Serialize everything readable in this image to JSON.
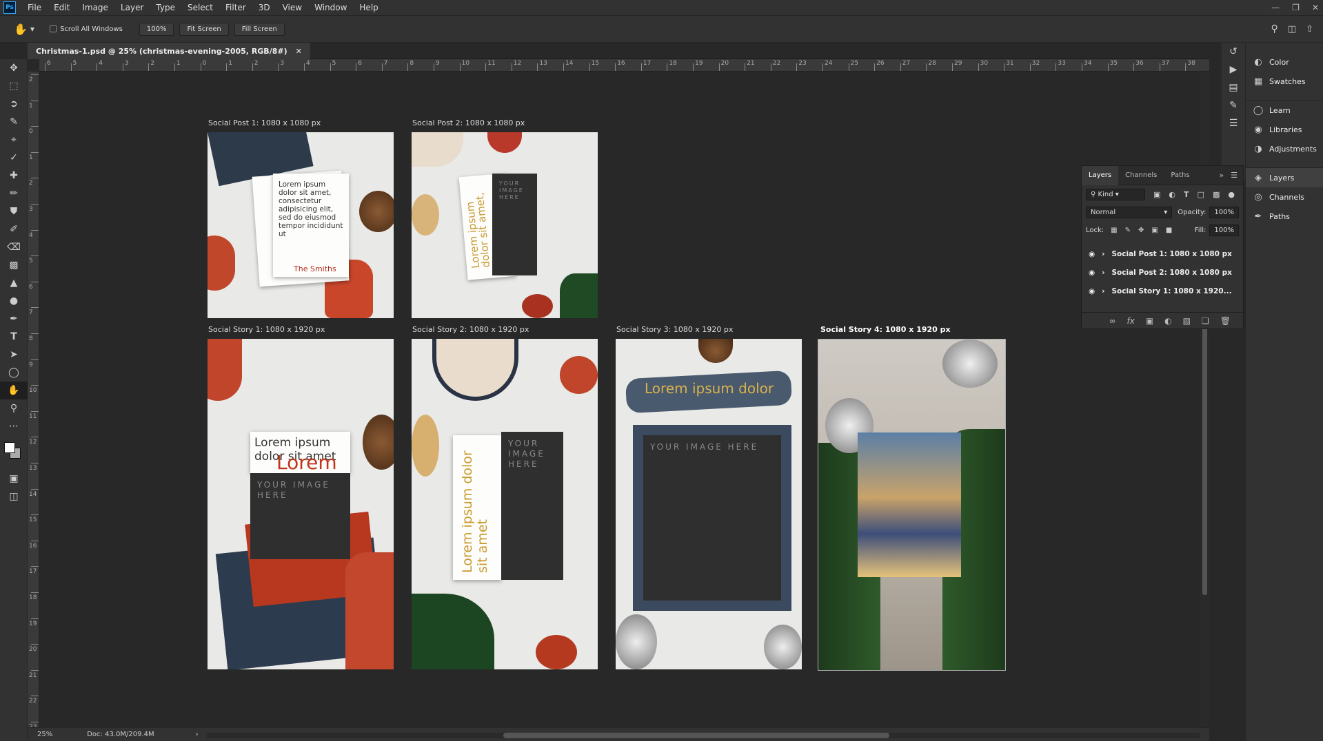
{
  "menu": [
    "File",
    "Edit",
    "Image",
    "Layer",
    "Type",
    "Select",
    "Filter",
    "3D",
    "View",
    "Window",
    "Help"
  ],
  "app_badge": "Ps",
  "options": {
    "scroll_all": "Scroll All Windows",
    "zoom_btn": "100%",
    "fit_screen": "Fit Screen",
    "fill_screen": "Fill Screen"
  },
  "document_tab": "Christmas-1.psd @ 25% (christmas-evening-2005, RGB/8#)",
  "ruler_h_labels": [
    "6",
    "5",
    "4",
    "3",
    "2",
    "1",
    "0",
    "1",
    "2",
    "3",
    "4",
    "5",
    "6",
    "7",
    "8",
    "9",
    "10",
    "11",
    "12",
    "13",
    "14",
    "15",
    "16",
    "17",
    "18",
    "19",
    "20",
    "21",
    "22",
    "23",
    "24",
    "25",
    "26",
    "27",
    "28",
    "29",
    "30",
    "31",
    "32",
    "33",
    "34",
    "35",
    "36",
    "37",
    "38"
  ],
  "ruler_v_labels": [
    "2",
    "1",
    "0",
    "1",
    "2",
    "3",
    "4",
    "5",
    "6",
    "7",
    "8",
    "9",
    "10",
    "11",
    "12",
    "13",
    "14",
    "15",
    "16",
    "17",
    "18",
    "19",
    "20",
    "21",
    "22",
    "23"
  ],
  "artboards": [
    {
      "label": "Social Post 1: 1080 x 1080 px"
    },
    {
      "label": "Social Post 2: 1080 x 1080 px"
    },
    {
      "label": "Social Story 1: 1080 x 1920 px"
    },
    {
      "label": "Social Story 2: 1080 x 1920 px"
    },
    {
      "label": "Social Story 3: 1080 x 1920 px"
    },
    {
      "label": "Social Story 4: 1080 x 1920 px"
    }
  ],
  "art_text": {
    "post1_card": "Lorem ipsum dolor sit amet, consectetur adipisicing elit, sed do eiusmod tempor incididunt ut",
    "post1_sign": "The Smiths",
    "post2_gold": "Lorem ipsum dolor sit amet,",
    "placeholder_top": "YOUR IMAGE HERE",
    "story1_text": "Lorem ipsum dolor sit amet",
    "story1_red": "Lorem",
    "story2_gold": "Lorem ipsum dolor sit amet",
    "story3_title": "Lorem ipsum dolor"
  },
  "status": {
    "zoom": "25%",
    "doc": "Doc: 43.0M/209.4M"
  },
  "dock": {
    "group1": [
      {
        "icon": "color-icon",
        "label": "Color"
      },
      {
        "icon": "swatches-icon",
        "label": "Swatches"
      }
    ],
    "group2": [
      {
        "icon": "learn-icon",
        "label": "Learn"
      },
      {
        "icon": "libraries-icon",
        "label": "Libraries"
      },
      {
        "icon": "adjustments-icon",
        "label": "Adjustments"
      }
    ],
    "group3": [
      {
        "icon": "layers-icon",
        "label": "Layers"
      },
      {
        "icon": "channels-icon",
        "label": "Channels"
      },
      {
        "icon": "paths-icon",
        "label": "Paths"
      }
    ]
  },
  "layers_panel": {
    "tabs": [
      "Layers",
      "Channels",
      "Paths"
    ],
    "kind": "Kind",
    "blend": "Normal",
    "opacity_label": "Opacity:",
    "opacity": "100%",
    "lock_label": "Lock:",
    "fill_label": "Fill:",
    "fill": "100%",
    "layers": [
      "Social Post 1: 1080 x 1080 px",
      "Social Post 2: 1080 x 1080 px",
      "Social Story 1: 1080 x 1920..."
    ]
  }
}
